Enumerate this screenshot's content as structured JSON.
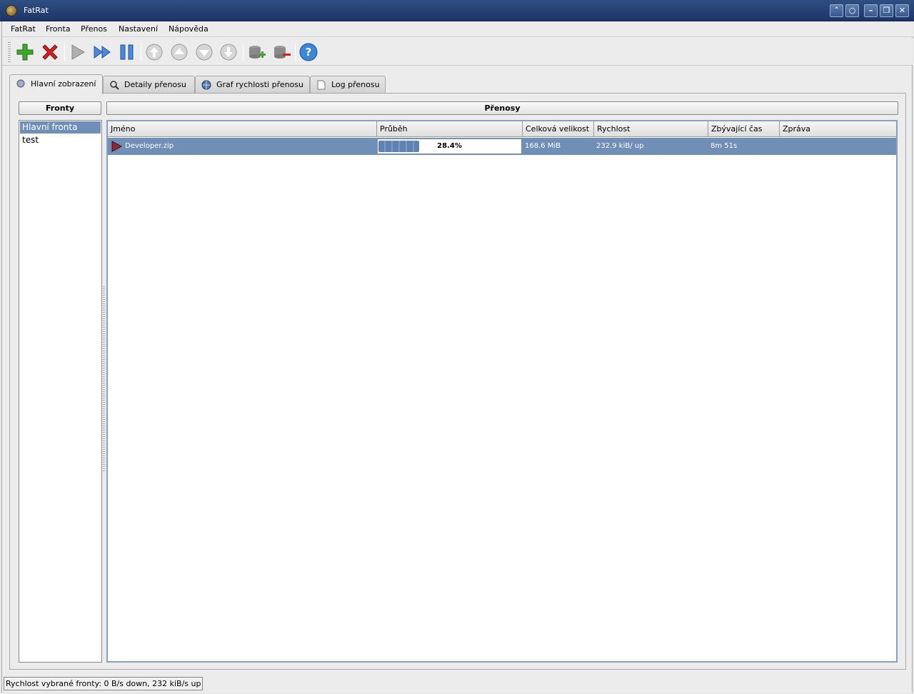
{
  "window": {
    "title": "FatRat"
  },
  "menu": [
    "FatRat",
    "Fronta",
    "Přenos",
    "Nastavení",
    "Nápověda"
  ],
  "toolbar": {
    "icons": [
      "add-transfer-icon",
      "delete-transfer-icon",
      "resume-icon",
      "force-resume-icon",
      "pause-icon",
      "move-top-icon",
      "move-up-icon",
      "move-down-icon",
      "move-bottom-icon",
      "add-queue-icon",
      "remove-queue-icon",
      "help-icon"
    ]
  },
  "tabs": [
    {
      "label": "Hlavní zobrazení"
    },
    {
      "label": "Detaily přenosu"
    },
    {
      "label": "Graf rychlosti přenosu"
    },
    {
      "label": "Log přenosu"
    }
  ],
  "queues": {
    "header": "Fronty",
    "items": [
      "Hlavní fronta",
      "test"
    ]
  },
  "transfers": {
    "header": "Přenosy",
    "columns": [
      "Jméno",
      "Průběh",
      "Celková velikost",
      "Rychlost",
      "Zbývající čas",
      "Zpráva"
    ],
    "rows": [
      {
        "name": "Developer.zip",
        "progress_text": "28.4%",
        "progress": 0.284,
        "size": "168.6 MiB",
        "speed": "232.9 kiB/ up",
        "remaining": "8m 51s",
        "message": ""
      }
    ]
  },
  "status": "Rychlost vybrané fronty: 0 B/s down, 232 kiB/s up",
  "colors": {
    "selection": "#6f8fb6",
    "titlebar": "#2f4f82"
  }
}
